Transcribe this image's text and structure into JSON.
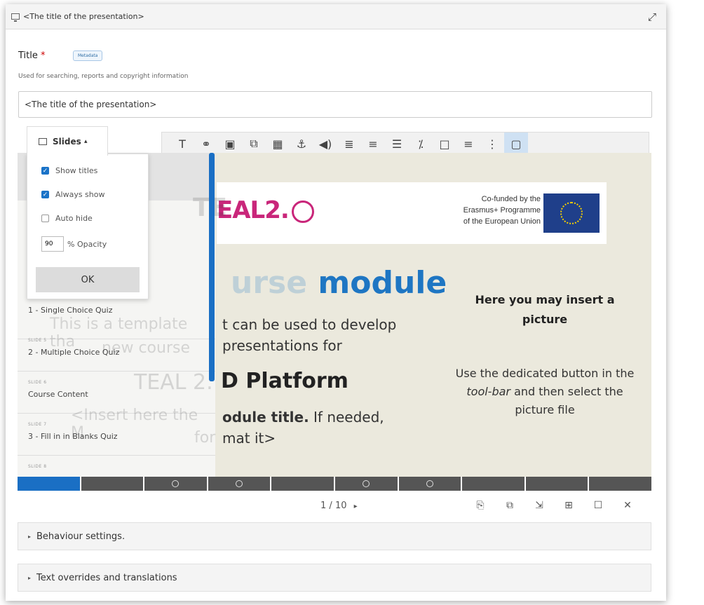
{
  "window": {
    "title": "<The title of the presentation>"
  },
  "form": {
    "title_label": "Title",
    "required_mark": "*",
    "metadata_badge": "Metadata",
    "hint": "Used for searching, reports and copyright information",
    "title_value": "<The title of the presentation>"
  },
  "toolbar": {
    "icons": [
      "T",
      "⚭",
      "▣",
      "⧉",
      "▦",
      "⚓",
      "◀)",
      "≣",
      "≡",
      "☰",
      "⁒",
      "□",
      "≡",
      "⋮",
      "▢"
    ]
  },
  "slides_menu": {
    "button_label": "Slides",
    "caret": "▴",
    "show_titles": "Show titles",
    "always_show": "Always show",
    "auto_hide": "Auto hide",
    "opacity_value": "90",
    "opacity_label": "% Opacity",
    "ok": "OK"
  },
  "slide_list": [
    {
      "label": "",
      "name": "1 - Single Choice Quiz"
    },
    {
      "label": "SLIDE 5",
      "name": "2 - Multiple Choice Quiz"
    },
    {
      "label": "SLIDE 6",
      "name": "Course Content"
    },
    {
      "label": "SLIDE 7",
      "name": "3 - Fill in in Blanks Quiz"
    },
    {
      "label": "SLIDE 8",
      "name": ""
    }
  ],
  "slide": {
    "logo_text": "EAL2.",
    "eu_line1": "Co-funded by the",
    "eu_line2": "Erasmus+ Programme",
    "eu_line3": "of the European Union",
    "heading_ghost": "urse",
    "heading": "module",
    "body": "t can be used to develop",
    "body2": "presentations for",
    "platform": "D Platform",
    "mod_title_bold": "odule title.",
    "mod_title_rest": " If needed,",
    "mod_title_line2": "mat it>",
    "ghost_template": "This is a template tha",
    "ghost_new": "new course",
    "ghost_teal": "TEAL 2.",
    "ghost_insert": "<Insert here the M",
    "ghost_for": "for",
    "ghost_te": "TE",
    "pic_heading": "Here you may insert a picture",
    "pic_text_1": "Use the dedicated button in the ",
    "pic_text_tool": "tool-bar",
    "pic_text_2": " and then select the picture file"
  },
  "progress": {
    "segments": 10,
    "current": 1,
    "quiz_dots": [
      3,
      4,
      6,
      7
    ]
  },
  "pager": {
    "current": "1",
    "sep": "/",
    "total": "10",
    "next": "▸"
  },
  "footer_icons": [
    "⎘",
    "⧉",
    "⇲",
    "⊞",
    "☐",
    "✕"
  ],
  "accordions": {
    "behaviour": "Behaviour settings.",
    "text_overrides": "Text overrides and translations"
  }
}
